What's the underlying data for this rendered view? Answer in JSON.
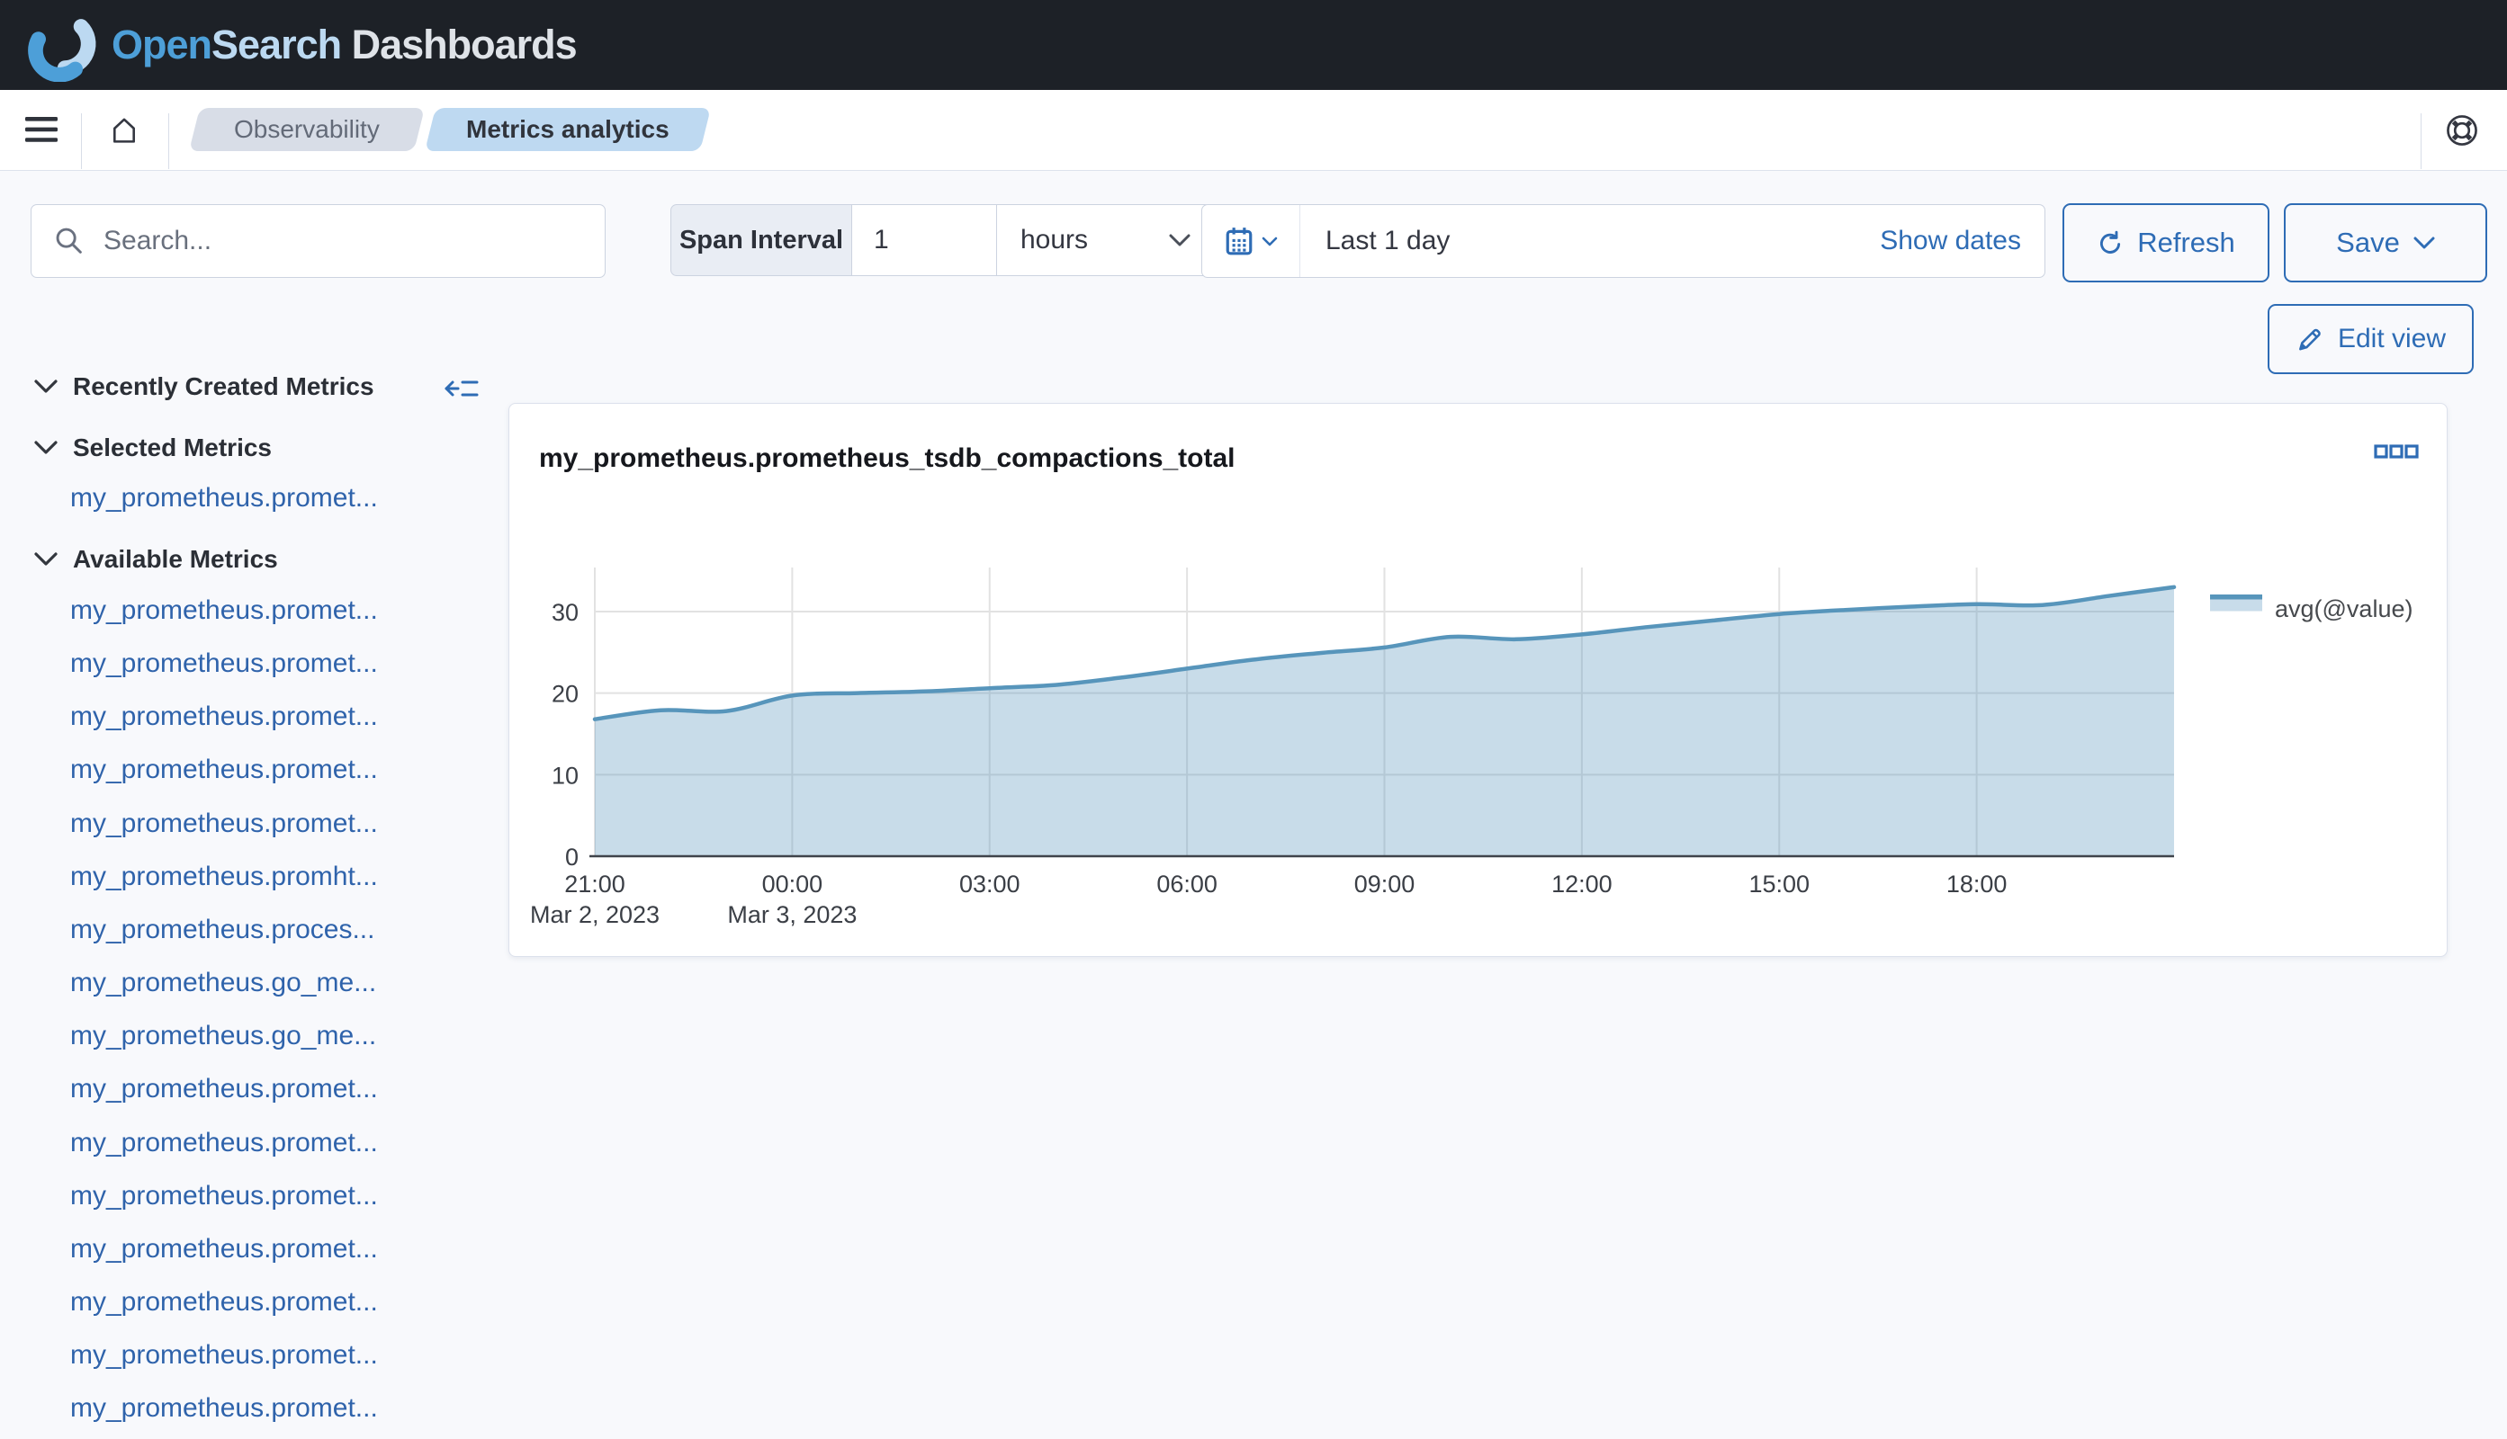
{
  "header": {
    "logo": {
      "open": "Open",
      "search": "Search",
      "rest": " Dashboards"
    }
  },
  "nav": {
    "breadcrumbs": [
      {
        "label": "Observability"
      },
      {
        "label": "Metrics analytics"
      }
    ]
  },
  "controls": {
    "search_placeholder": "Search...",
    "span": {
      "label": "Span Interval",
      "value": "1",
      "unit": "hours"
    },
    "date": {
      "range_label": "Last 1 day",
      "show_dates": "Show dates"
    },
    "refresh_label": "Refresh",
    "save_label": "Save",
    "edit_view_label": "Edit view"
  },
  "sidebar": {
    "recently": {
      "title": "Recently Created Metrics"
    },
    "selected": {
      "title": "Selected Metrics",
      "items": [
        "my_prometheus.promet..."
      ]
    },
    "available": {
      "title": "Available Metrics",
      "items": [
        "my_prometheus.promet...",
        "my_prometheus.promet...",
        "my_prometheus.promet...",
        "my_prometheus.promet...",
        "my_prometheus.promet...",
        "my_prometheus.promht...",
        "my_prometheus.proces...",
        "my_prometheus.go_me...",
        "my_prometheus.go_me...",
        "my_prometheus.promet...",
        "my_prometheus.promet...",
        "my_prometheus.promet...",
        "my_prometheus.promet...",
        "my_prometheus.promet...",
        "my_prometheus.promet...",
        "my_prometheus.promet..."
      ]
    }
  },
  "panel": {
    "title": "my_prometheus.prometheus_tsdb_compactions_total"
  },
  "chart_data": {
    "type": "area",
    "title": "my_prometheus.prometheus_tsdb_compactions_total",
    "x_start": "Mar 2, 2023 21:00",
    "x_hours_from_start": [
      0,
      1,
      2,
      3,
      4,
      5,
      6,
      7,
      8,
      9,
      10,
      11,
      12,
      13,
      14,
      15,
      16,
      17,
      18,
      19,
      20,
      21,
      22,
      23,
      24
    ],
    "series": [
      {
        "name": "avg(@value)",
        "values": [
          16.8,
          17.9,
          17.8,
          19.7,
          20.0,
          20.2,
          20.6,
          21.0,
          21.9,
          23.0,
          24.1,
          24.9,
          25.6,
          26.9,
          26.6,
          27.2,
          28.1,
          28.9,
          29.7,
          30.2,
          30.6,
          30.9,
          30.8,
          31.9,
          33.0
        ]
      }
    ],
    "x_ticks": [
      {
        "hour": 0,
        "label": "21:00",
        "sub": "Mar 2, 2023"
      },
      {
        "hour": 3,
        "label": "00:00",
        "sub": "Mar 3, 2023"
      },
      {
        "hour": 6,
        "label": "03:00"
      },
      {
        "hour": 9,
        "label": "06:00"
      },
      {
        "hour": 12,
        "label": "09:00"
      },
      {
        "hour": 15,
        "label": "12:00"
      },
      {
        "hour": 18,
        "label": "15:00"
      },
      {
        "hour": 21,
        "label": "18:00"
      }
    ],
    "y_ticks": [
      "0",
      "10",
      "20",
      "30"
    ],
    "ylim": [
      0,
      35.4
    ],
    "grid": true,
    "legend_position": "right"
  },
  "colors": {
    "accent_blue": "#2e6cb5",
    "link_blue": "#2f63ab",
    "line": "#5795bb",
    "area_fill": "#c8dcea",
    "header_bg": "#1d2127",
    "crumb_active_bg": "#bed9f1",
    "crumb_bg": "#d8dde7"
  },
  "icons": {
    "menu": "hamburger",
    "home": "house-outline",
    "help": "life-ring",
    "search": "magnifier",
    "calendar": "calendar-grid",
    "chevron_down": "v",
    "refresh": "circular-arrow",
    "save_caret": "v",
    "pencil": "edit-pencil",
    "collapse": "arrow-left-into-lines",
    "panel_actions": "three-hollow-squares"
  }
}
